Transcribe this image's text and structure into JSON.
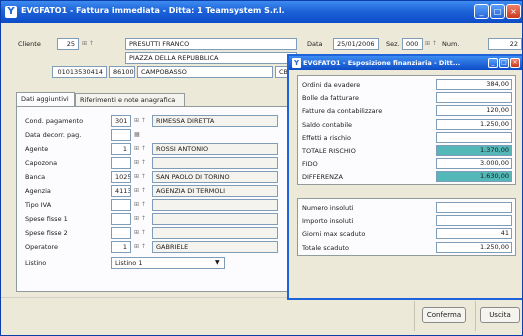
{
  "window": {
    "title": "EVGFATO1 - Fattura immediata - Ditta: 1 Teamsystem S.r.l.",
    "logo": "Y"
  },
  "header": {
    "cliente_label": "Cliente",
    "cliente_code": "25",
    "cliente_name": "PRESUTTI FRANCO",
    "address": "PIAZZA DELLA REPUBBLICA",
    "piva": "01013530414",
    "cap": "86100",
    "city": "CAMPOBASSO",
    "prov": "CB",
    "data_label": "Data",
    "data_value": "25/01/2006",
    "sez_label": "Sez.",
    "sez_value": "000",
    "num_label": "Num.",
    "num_value": "22"
  },
  "tabs": [
    {
      "label": "Dati aggiuntivi"
    },
    {
      "label": "Riferimenti e note anagrafica"
    }
  ],
  "form": {
    "rows": [
      {
        "label": "Cond. pagamento",
        "code": "301",
        "desc": "RIMESSA DIRETTA"
      },
      {
        "label": "Data decorr. pag.",
        "code": "",
        "desc": ""
      },
      {
        "label": "Agente",
        "code": "1",
        "desc": "ROSSI ANTONIO"
      },
      {
        "label": "Capozona",
        "code": "",
        "desc": ""
      },
      {
        "label": "Banca",
        "code": "1025",
        "desc": "SAN PAOLO DI TORINO"
      },
      {
        "label": "Agenzia",
        "code": "41130",
        "desc": "AGENZIA DI TERMOLI"
      },
      {
        "label": "Tipo IVA",
        "code": "",
        "desc": ""
      },
      {
        "label": "Spese fisse 1",
        "code": "",
        "desc": ""
      },
      {
        "label": "Spese fisse 2",
        "code": "",
        "desc": ""
      },
      {
        "label": "Operatore",
        "code": "1",
        "desc": "GABRIELE"
      }
    ],
    "listino_label": "Listino",
    "listino_value": "Listino 1"
  },
  "buttons": {
    "conferma": "Conferma",
    "uscita": "Uscita"
  },
  "popup": {
    "title": "EVGFATO1 - Esposizione finanziaria - Ditt...",
    "logo": "Y",
    "group1": [
      {
        "label": "Ordini da evadere",
        "value": "384,00",
        "highlight": false
      },
      {
        "label": "Bolle da fatturare",
        "value": "",
        "highlight": false
      },
      {
        "label": "Fatture da contabilizzare",
        "value": "120,00",
        "highlight": false
      },
      {
        "label": "Saldo contabile",
        "value": "1.250,00",
        "highlight": false
      },
      {
        "label": "Effetti a rischio",
        "value": "",
        "highlight": false
      },
      {
        "label": "TOTALE RISCHIO",
        "value": "1.370,00",
        "highlight": true
      },
      {
        "label": "FIDO",
        "value": "3.000,00",
        "highlight": false
      },
      {
        "label": "DIFFERENZA",
        "value": "1.630,00",
        "highlight": true
      }
    ],
    "group2": [
      {
        "label": "Numero insoluti",
        "value": ""
      },
      {
        "label": "Importo insoluti",
        "value": ""
      },
      {
        "label": "Giorni max scaduto",
        "value": "41"
      },
      {
        "label": "Totale scaduto",
        "value": "1.250,00"
      }
    ]
  }
}
